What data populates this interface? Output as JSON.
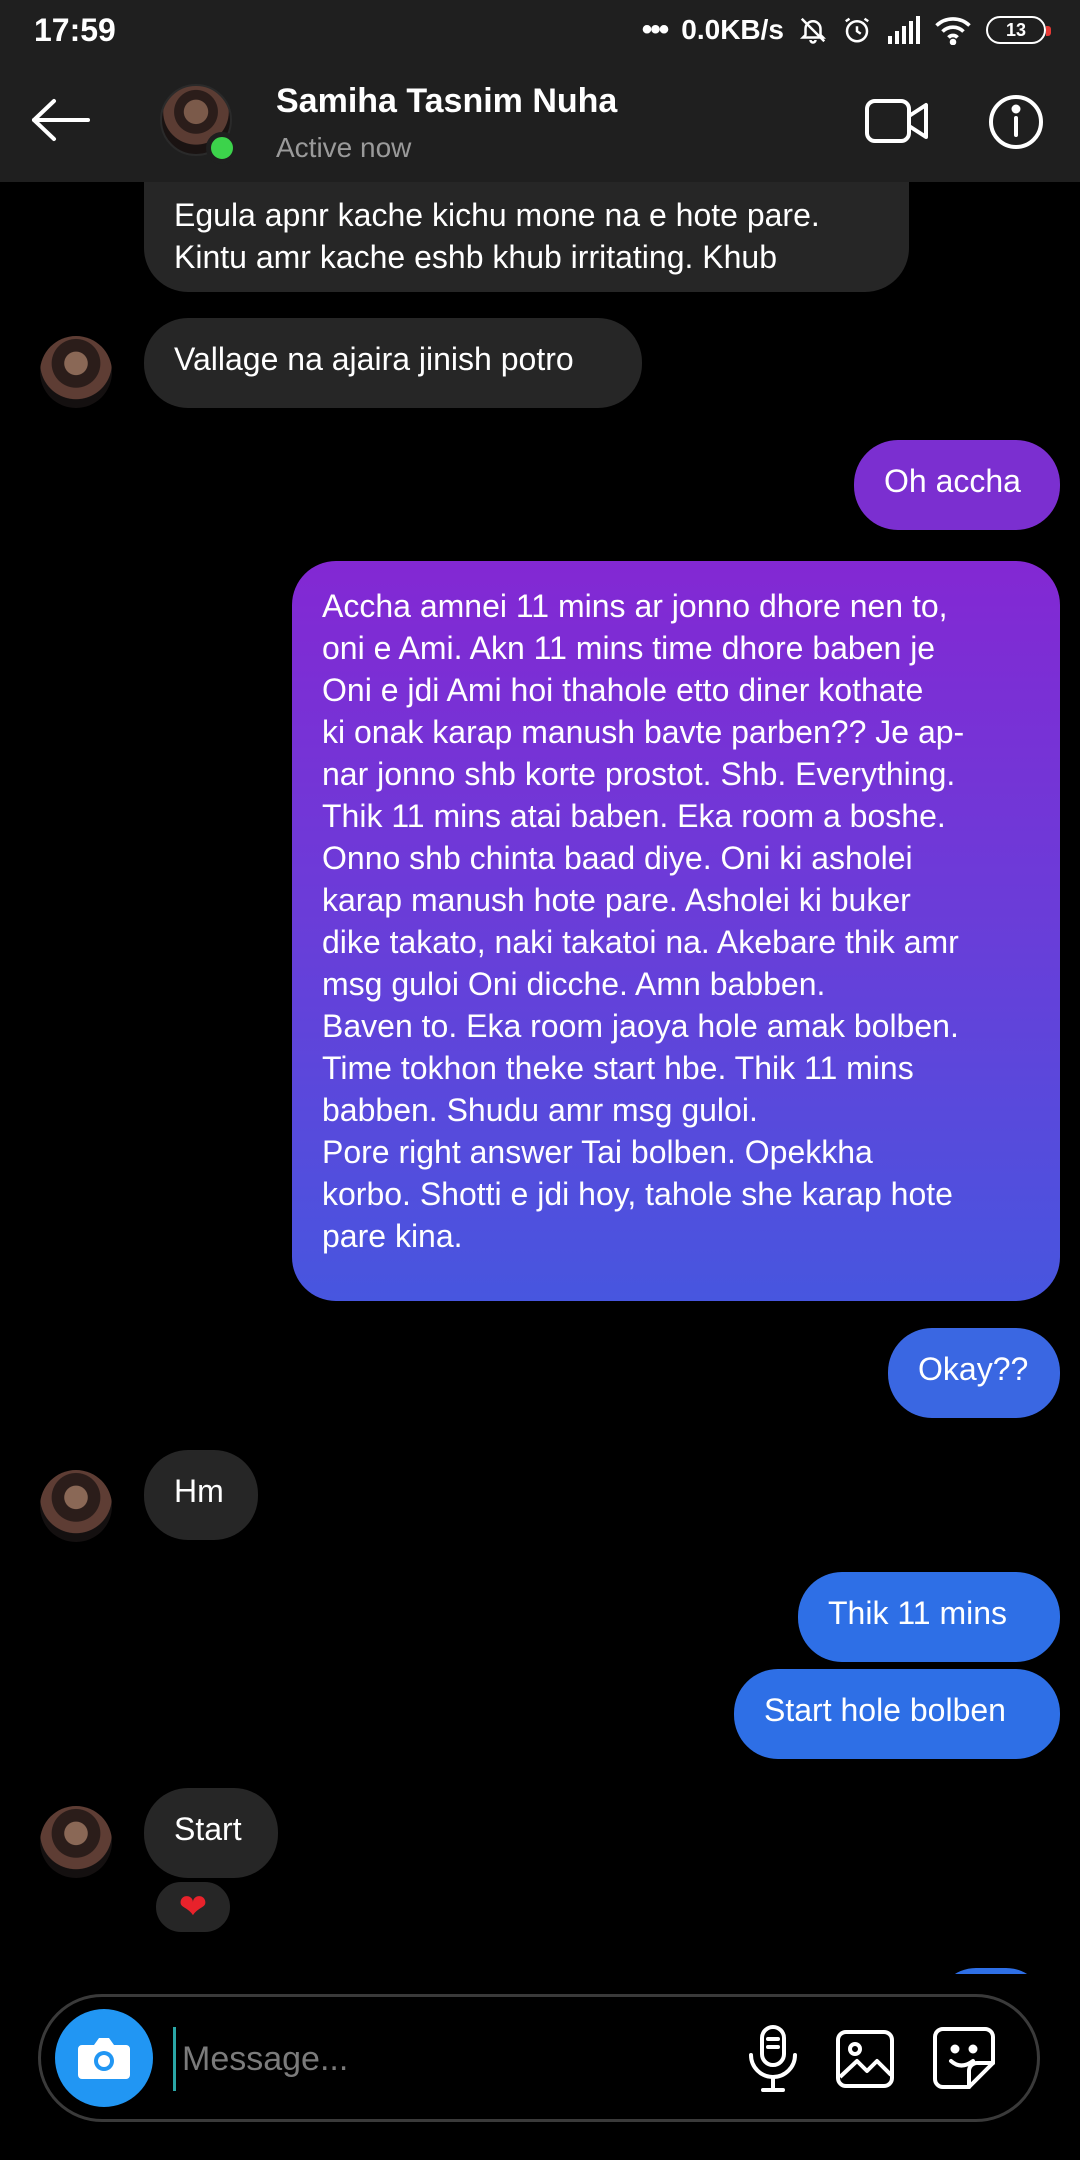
{
  "status_bar": {
    "time": "17:59",
    "network_speed": "0.0KB/s",
    "battery": "13",
    "icons": [
      "dots-icon",
      "mute-bell-icon",
      "alarm-icon",
      "signal-icon",
      "wifi-icon",
      "battery-icon"
    ]
  },
  "header": {
    "name": "Samiha Tasnim Nuha",
    "status": "Active now",
    "icons": [
      "back-arrow-icon",
      "video-call-icon",
      "info-icon"
    ],
    "online_color": "#3cd34b"
  },
  "messages": [
    {
      "side": "in",
      "text": "Egula apnr kache kichu mone na e hote pare.\nKintu amr kache eshb khub irritating. Khub"
    },
    {
      "side": "in",
      "text": "Vallage na ajaira jinish potro"
    },
    {
      "side": "out",
      "text": "Oh accha"
    },
    {
      "side": "out",
      "text": "Accha amnei 11 mins ar jonno dhore nen to,\noni e Ami. Akn 11 mins time dhore baben je\nOni e jdi Ami hoi thahole  etto diner kothate\nki onak karap manush bavte parben?? Je ap-\nnar jonno shb korte prostot. Shb. Everything.\nThik 11 mins atai baben. Eka room a boshe.\nOnno shb chinta baad diye. Oni ki asholei\nkarap manush hote pare. Asholei ki buker\ndike takato, naki takatoi na. Akebare thik amr\nmsg guloi Oni dicche. Amn babben.\nBaven to. Eka room jaoya hole amak bolben.\nTime tokhon theke start hbe. Thik 11 mins\nbabben. Shudu amr msg guloi.\nPore right answer Tai bolben. Opekkha\nkorbo. Shotti e jdi hoy, tahole she karap hote\npare kina."
    },
    {
      "side": "out",
      "text": "Okay??"
    },
    {
      "side": "in",
      "text": "Hm"
    },
    {
      "side": "out",
      "text": "Thik 11 mins"
    },
    {
      "side": "out",
      "text": "Start hole bolben"
    },
    {
      "side": "in",
      "text": "Start",
      "reaction": "❤"
    }
  ],
  "composer": {
    "placeholder": "Message...",
    "icons": [
      "camera-icon",
      "microphone-icon",
      "gallery-icon",
      "sticker-icon"
    ],
    "camera_color": "#2196f3"
  }
}
